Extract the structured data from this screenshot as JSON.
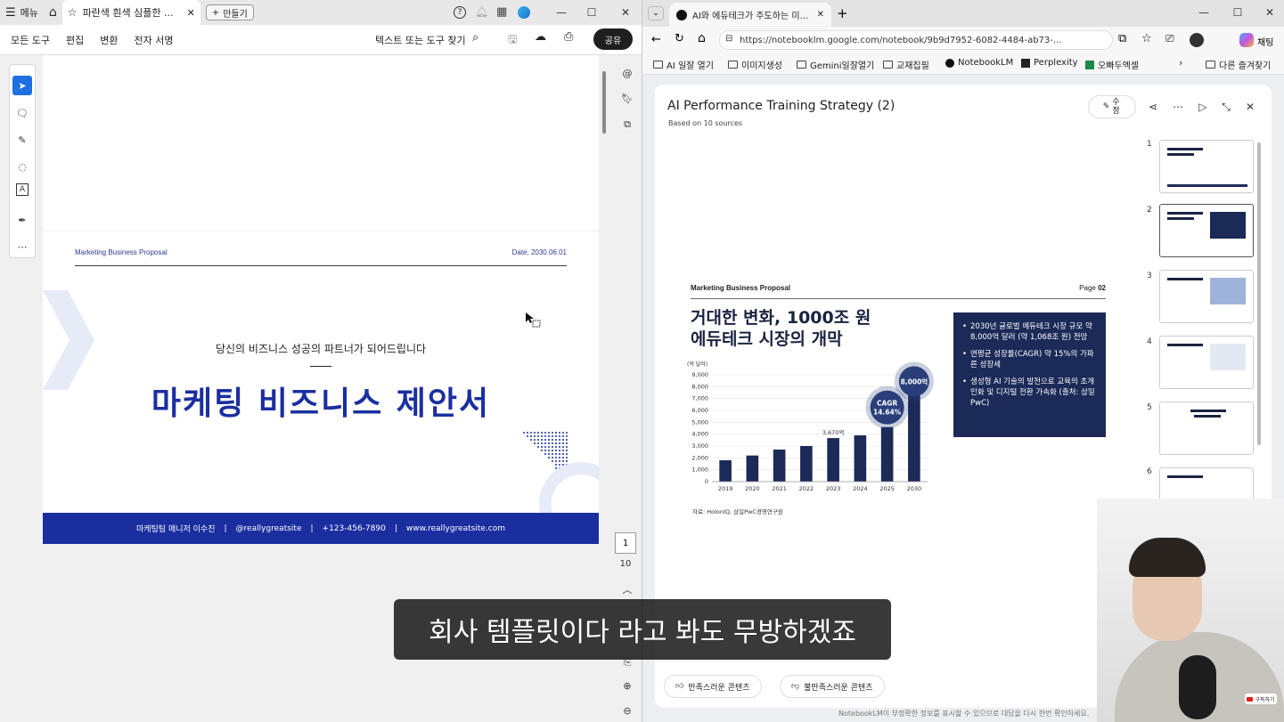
{
  "pdf_app": {
    "menu_label": "메뉴",
    "tab_title": "파란색 흰색 심플한 ...",
    "new_tab_label": "만들기",
    "toolbar": {
      "all_tools": "모든 도구",
      "edit": "편집",
      "convert": "변환",
      "e_sign": "전자 서명",
      "search_label": "텍스트 또는 도구 찾기",
      "share": "공유"
    },
    "page": {
      "header_left": "Marketing Business Proposal",
      "header_right": "Date, 2030.06.01",
      "subtitle": "당신의 비즈니스 성공의 파트너가 되어드립니다",
      "title": "마케팅 비즈니스 제안서",
      "footer": [
        "마케팅팀 매니저 이수진",
        "|",
        "@reallygreatsite",
        "|",
        "+123-456-7890",
        "|",
        "www.reallygreatsite.com"
      ]
    },
    "page_current": "1",
    "page_total": "10",
    "accent_color": "#1b2ea0"
  },
  "browser": {
    "tab_title": "AI와 에듀테크가 주도하는 미래 교",
    "profile_label": "채팅",
    "url": "https://notebooklm.google.com/notebook/9b9d7952-6082-4484-ab73-...",
    "bookmarks": [
      "AI 일잘 열기",
      "이미지생성",
      "Gemini일잘열기",
      "교재집필",
      "NotebookLM",
      "Perplexity",
      "오빠두엑셀",
      "다른 즐겨찾기"
    ]
  },
  "panel": {
    "title": "AI Performance Training Strategy (2)",
    "subtitle": "Based on 10 sources",
    "edit_label": "수정",
    "thumbnails": [
      "1",
      "2",
      "3",
      "4",
      "5",
      "6"
    ],
    "good_btn": "만족스러운 콘텐츠",
    "bad_btn": "불만족스러운 콘텐츠",
    "footer_note": "NotebookLM이 부정확한 정보를 표시할 수 있으므로 대답을 다시 한번 확인하세요."
  },
  "slide": {
    "header_left": "Marketing Business Proposal",
    "header_page_label": "Page",
    "header_page_num": "02",
    "title_line1": "거대한 변화, 1000조 원",
    "title_line2": "에듀테크 시장의 개막",
    "box_points": [
      "2030년 글로벌 에듀테크 시장 규모 약 8,000억 달러 (약 1,068조 원) 전망",
      "연평균 성장률(CAGR) 약 15%의 가파른 성장세",
      "생성형 AI 기술의 발전으로 교육의 초개인화 및 디지털 전환 가속화 (출처: 삼일PwC)"
    ],
    "source": "자료: HolonIQ, 삼일PwC경영연구원"
  },
  "chart_data": {
    "type": "bar",
    "ylabel": "(억 달러)",
    "ylim": [
      0,
      9000
    ],
    "yticks": [
      0,
      1000,
      2000,
      3000,
      4000,
      5000,
      6000,
      7000,
      8000,
      9000
    ],
    "ytick_labels": [
      "0",
      "1,000",
      "2,000",
      "3,000",
      "4,000",
      "5,000",
      "6,000",
      "7,000",
      "8,000",
      "9,000"
    ],
    "categories": [
      "2019",
      "2020",
      "2021",
      "2022",
      "2023",
      "2024",
      "2025",
      "2030"
    ],
    "values": [
      1800,
      2200,
      2700,
      3000,
      3670,
      3900,
      4600,
      8000
    ],
    "annotations": [
      {
        "category": "2023",
        "text": "3,670억"
      },
      {
        "category": "2025",
        "text": "CAGR 14.64%"
      },
      {
        "category": "2030",
        "text": "8,000억"
      }
    ],
    "bar_color": "#1b2a57",
    "grid": true
  },
  "caption": "회사 템플릿이다 라고 봐도 무방하겠죠",
  "cam": {
    "subscribe": "구독하기"
  }
}
